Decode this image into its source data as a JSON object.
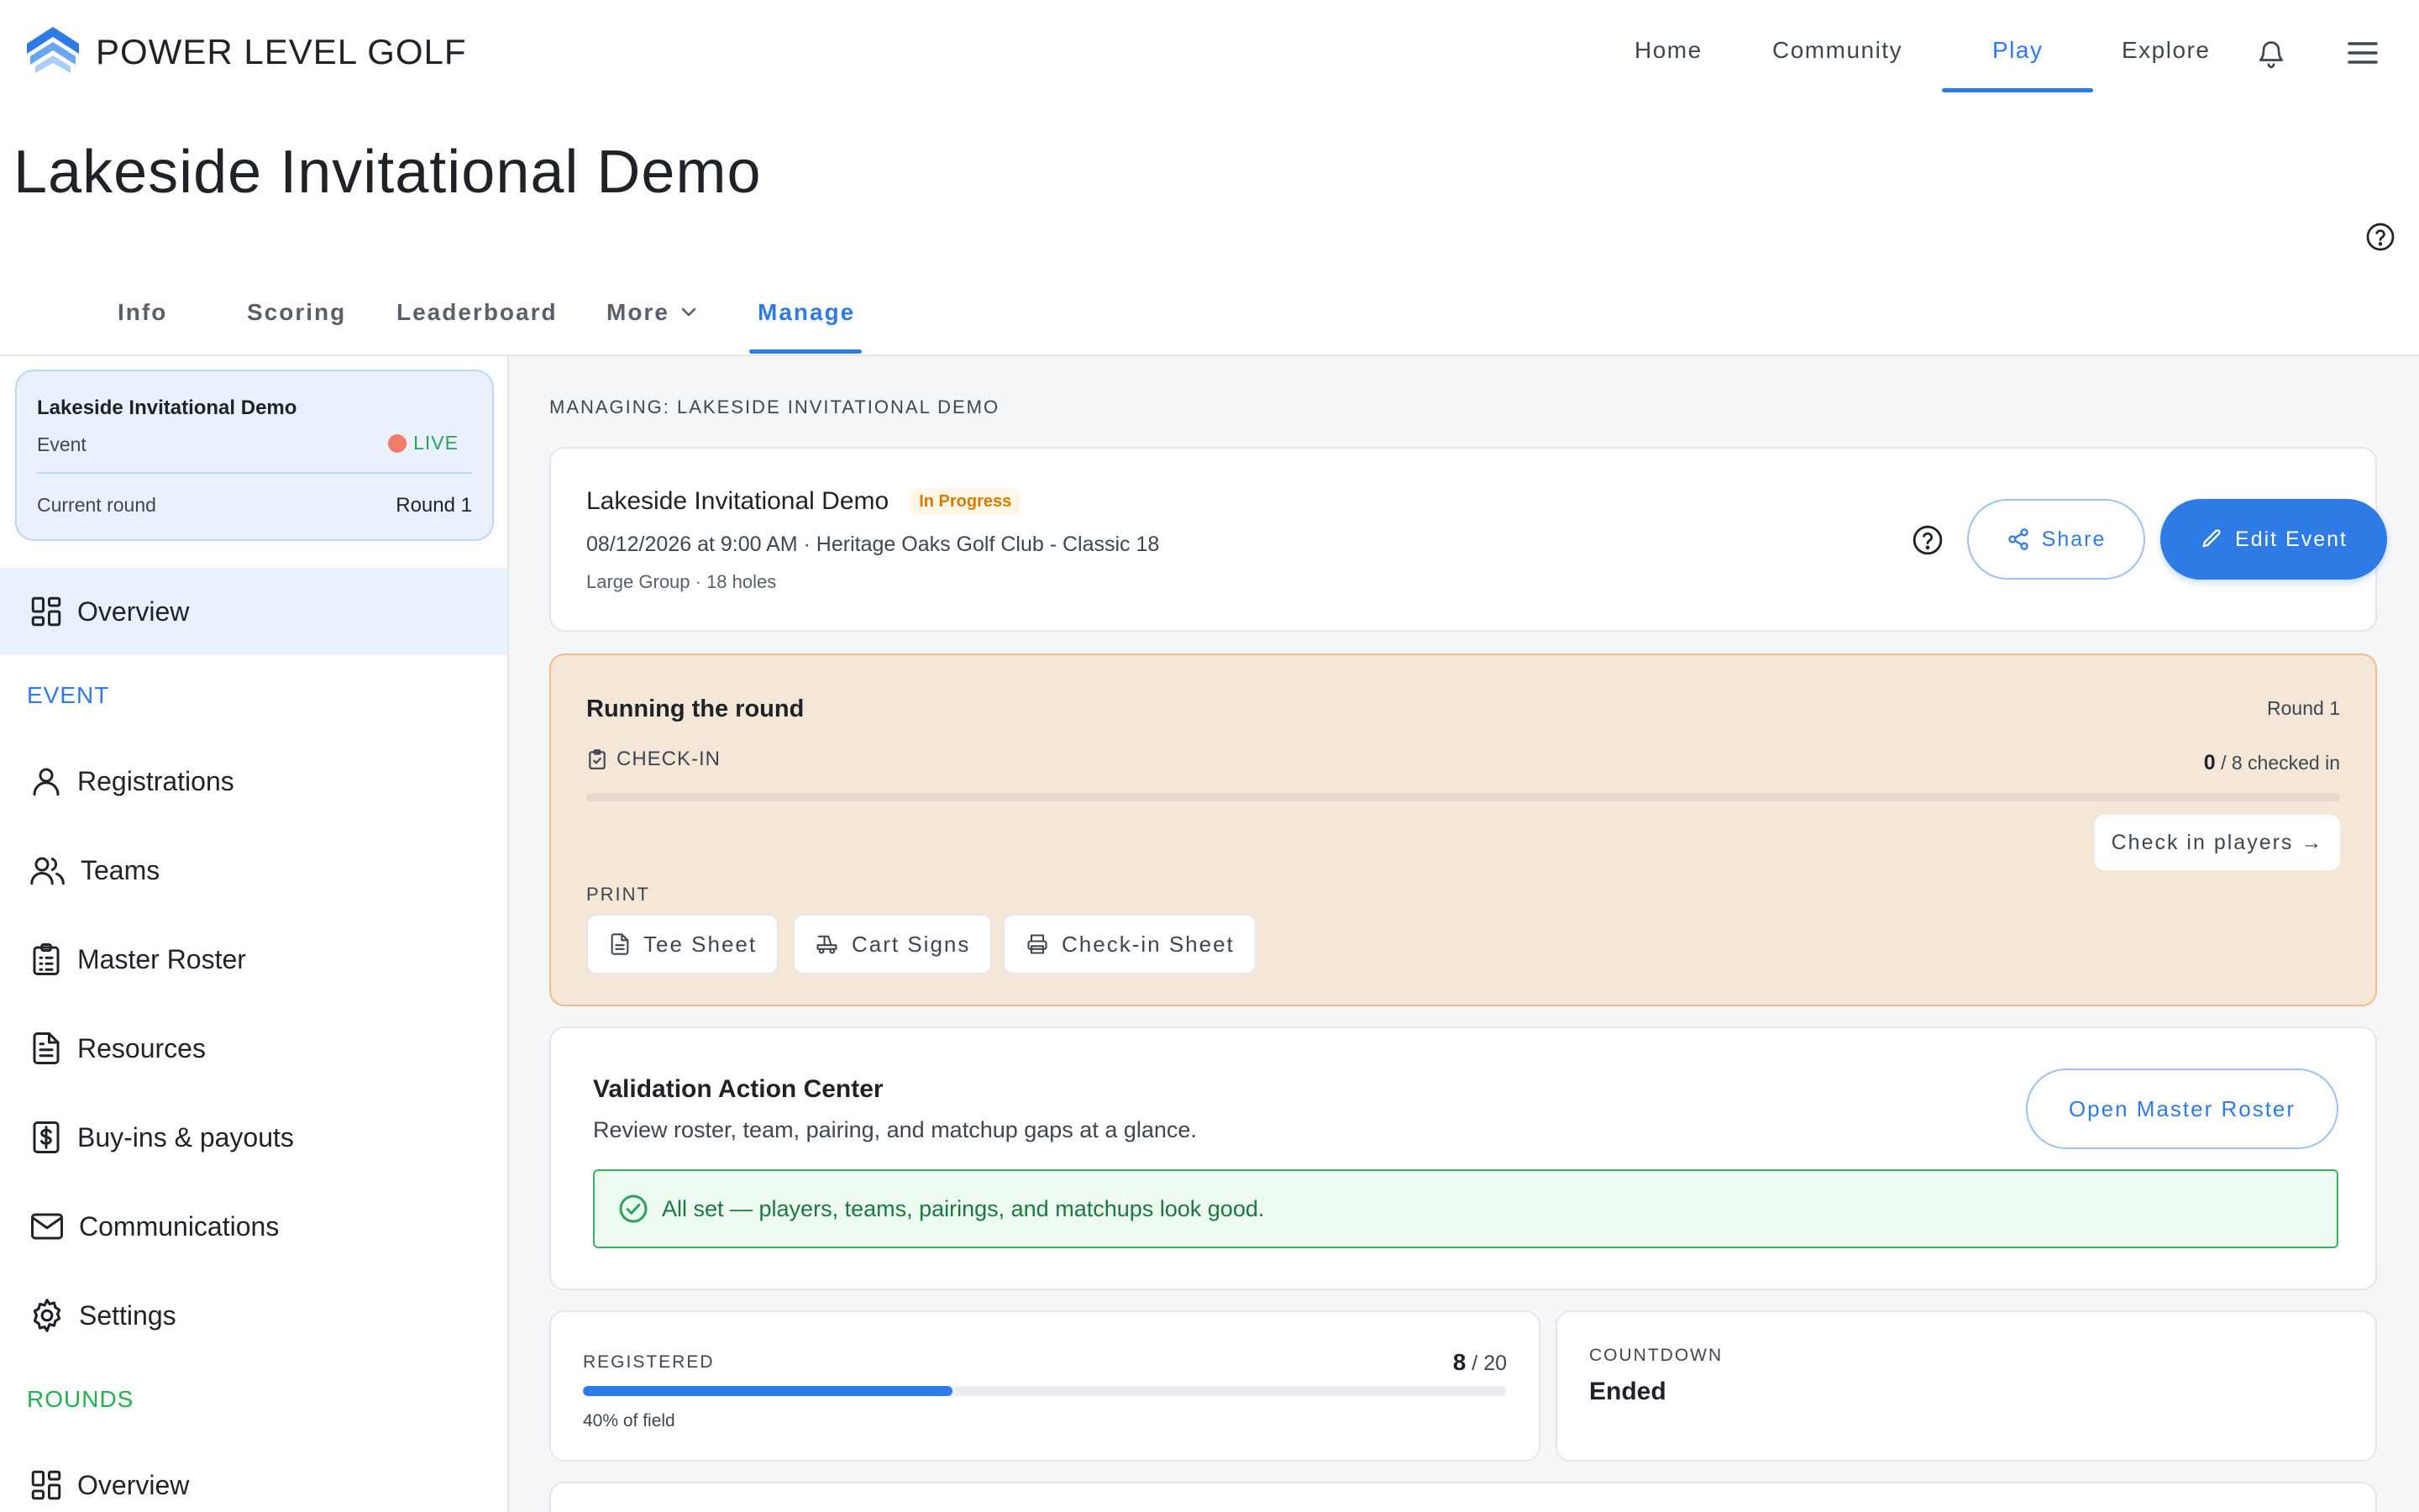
{
  "app": {
    "brand": "POWER LEVEL GOLF",
    "accent": "#2f7be6"
  },
  "nav": {
    "items": [
      {
        "label": "Home",
        "active": false
      },
      {
        "label": "Community",
        "active": false
      },
      {
        "label": "Play",
        "active": true
      },
      {
        "label": "Explore",
        "active": false
      }
    ],
    "icons": [
      "bell-icon",
      "menu-icon"
    ]
  },
  "page": {
    "title": "Lakeside Invitational Demo"
  },
  "tabs": [
    {
      "label": "Info"
    },
    {
      "label": "Scoring"
    },
    {
      "label": "Leaderboard"
    },
    {
      "label": "More"
    },
    {
      "label": "Manage",
      "active": true
    }
  ],
  "sidebar": {
    "event_card": {
      "title": "Lakeside Invitational Demo",
      "type": "Event",
      "status": "LIVE",
      "round_label": "Current round",
      "round_value": "Round 1"
    },
    "overview_label": "Overview",
    "event_section": "EVENT",
    "event_items": [
      {
        "label": "Registrations",
        "icon": "user-icon"
      },
      {
        "label": "Teams",
        "icon": "users-icon"
      },
      {
        "label": "Master Roster",
        "icon": "clipboard-list-icon"
      },
      {
        "label": "Resources",
        "icon": "document-icon"
      },
      {
        "label": "Buy-ins & payouts",
        "icon": "dollar-icon"
      },
      {
        "label": "Communications",
        "icon": "mail-icon"
      },
      {
        "label": "Settings",
        "icon": "gear-icon"
      }
    ],
    "rounds_section": "ROUNDS",
    "rounds_overview_label": "Overview",
    "colors": {
      "event_section": "#2f7be6",
      "rounds_section": "#22b14c"
    }
  },
  "main": {
    "managing": "MANAGING: LAKESIDE INVITATIONAL DEMO",
    "summary": {
      "title": "Lakeside Invitational Demo",
      "badge": "In Progress",
      "subtitle": "08/12/2026 at 9:00 AM · Heritage Oaks Golf Club - Classic 18",
      "details": "Large Group · 18 holes",
      "share_label": "Share",
      "edit_label": "Edit Event"
    },
    "running": {
      "title": "Running the round",
      "round": "Round 1",
      "checkin_label": "CHECK-IN",
      "checked_count": "0",
      "checked_total": "/ 8 checked in",
      "checkin_progress": 0,
      "checkin_button": "Check in players →",
      "print_label": "PRINT",
      "print_buttons": [
        {
          "label": "Tee Sheet",
          "icon": "document-icon"
        },
        {
          "label": "Cart Signs",
          "icon": "golf-cart-icon"
        },
        {
          "label": "Check-in Sheet",
          "icon": "printer-icon"
        }
      ]
    },
    "validation": {
      "title": "Validation Action Center",
      "subtitle": "Review roster, team, pairing, and matchup gaps at a glance.",
      "button": "Open Master Roster",
      "status": "All set — players, teams, pairings, and matchups look good."
    },
    "registered": {
      "label": "REGISTERED",
      "count": "8",
      "total": "/ 20",
      "percent_text": "40% of field",
      "fill_fraction": 0.4
    },
    "countdown": {
      "label": "COUNTDOWN",
      "value": "Ended"
    }
  }
}
